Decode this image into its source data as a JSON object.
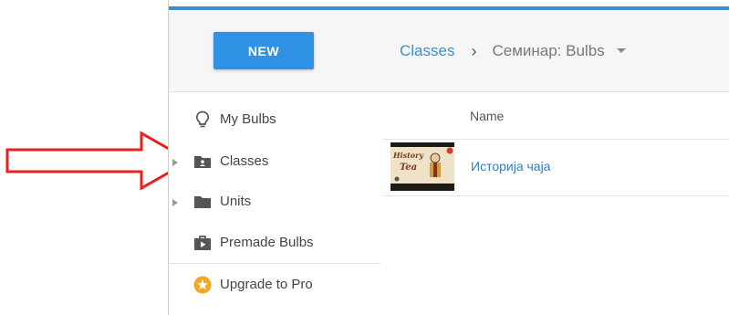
{
  "toolbar": {
    "new_label": "NEW"
  },
  "breadcrumb": {
    "root": "Classes",
    "separator": "›",
    "current": "Семинар: Bulbs"
  },
  "sidebar": {
    "items": [
      {
        "label": "My Bulbs",
        "icon": "lightbulb-icon",
        "expandable": false
      },
      {
        "label": "Classes",
        "icon": "class-folder-icon",
        "expandable": true
      },
      {
        "label": "Units",
        "icon": "folder-icon",
        "expandable": true
      },
      {
        "label": "Premade Bulbs",
        "icon": "premade-bulbs-icon",
        "expandable": false
      },
      {
        "label": "Upgrade to Pro",
        "icon": "star-badge-icon",
        "expandable": false
      }
    ]
  },
  "table": {
    "columns": [
      "Name"
    ],
    "rows": [
      {
        "name": "Историја чаја",
        "thumbnail_icon": "history-of-tea-thumbnail"
      }
    ]
  },
  "colors": {
    "accent": "#2f92e4",
    "link": "#3f8fc6",
    "upgrade_badge": "#f5a623",
    "annotation_arrow": "#e8211c"
  }
}
